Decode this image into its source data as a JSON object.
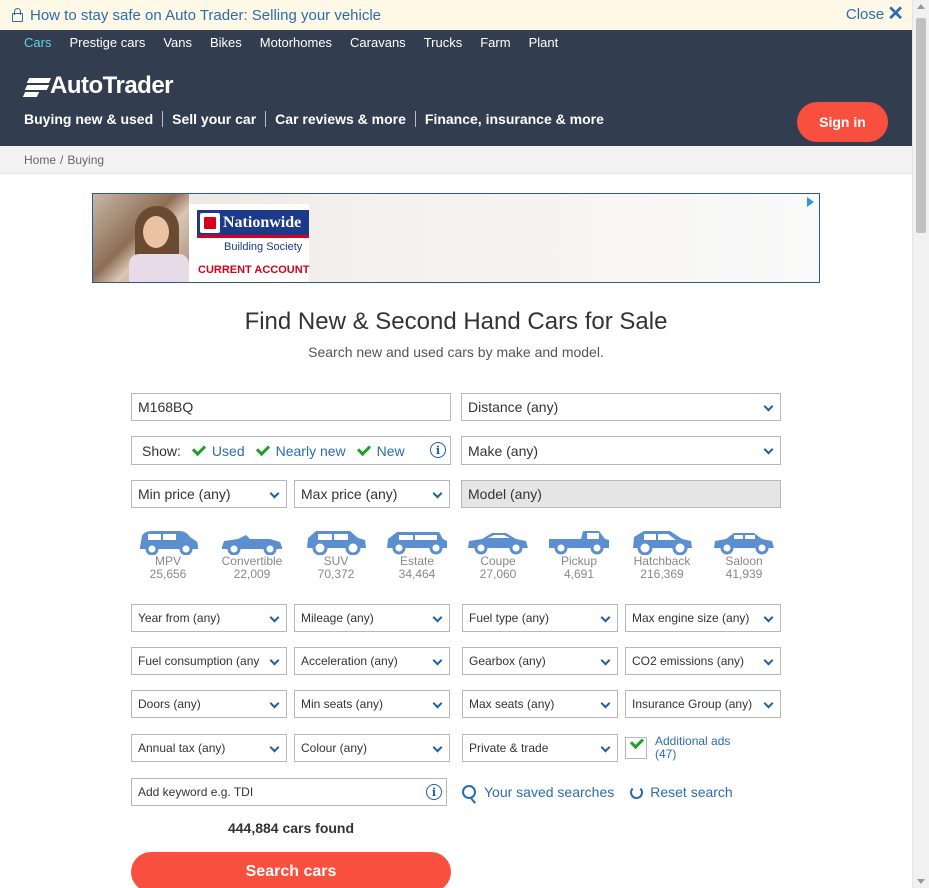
{
  "notice": {
    "message": "How to stay safe on Auto Trader: Selling your vehicle",
    "close_label": "Close"
  },
  "vehicle_tabs": [
    "Cars",
    "Prestige cars",
    "Vans",
    "Bikes",
    "Motorhomes",
    "Caravans",
    "Trucks",
    "Farm",
    "Plant"
  ],
  "logo_text": "AutoTrader",
  "main_nav": [
    "Buying new & used",
    "Sell your car",
    "Car reviews & more",
    "Finance, insurance & more"
  ],
  "sign_in": "Sign in",
  "breadcrumb": {
    "home": "Home",
    "current": "Buying"
  },
  "ad": {
    "brand": "Nationwide",
    "sub": "Building Society",
    "product": "CURRENT ACCOUNT"
  },
  "heading": "Find New & Second Hand Cars for Sale",
  "subheading": "Search new and used cars by make and model.",
  "search": {
    "postcode": "M168BQ",
    "distance": "Distance (any)",
    "show_label": "Show:",
    "show_options": [
      "Used",
      "Nearly new",
      "New"
    ],
    "make": "Make (any)",
    "min_price": "Min price (any)",
    "max_price": "Max price (any)",
    "model": "Model (any)"
  },
  "body_types": [
    {
      "name": "MPV",
      "count": "25,656"
    },
    {
      "name": "Convertible",
      "count": "22,009"
    },
    {
      "name": "SUV",
      "count": "70,372"
    },
    {
      "name": "Estate",
      "count": "34,464"
    },
    {
      "name": "Coupe",
      "count": "27,060"
    },
    {
      "name": "Pickup",
      "count": "4,691"
    },
    {
      "name": "Hatchback",
      "count": "216,369"
    },
    {
      "name": "Saloon",
      "count": "41,939"
    }
  ],
  "filters": {
    "year_from": "Year from (any)",
    "mileage": "Mileage (any)",
    "fuel_type": "Fuel type (any)",
    "max_engine": "Max engine size (any)",
    "fuel_consumption": "Fuel consumption (any",
    "acceleration": "Acceleration (any)",
    "gearbox": "Gearbox (any)",
    "co2": "CO2 emissions (any)",
    "doors": "Doors (any)",
    "min_seats": "Min seats (any)",
    "max_seats": "Max seats (any)",
    "insurance": "Insurance Group (any)",
    "annual_tax": "Annual tax (any)",
    "colour": "Colour (any)",
    "seller": "Private & trade",
    "additional_ads_line1": "Additional ads",
    "additional_ads_line2": "(47)"
  },
  "keyword_placeholder": "Add keyword e.g. TDI",
  "saved_searches": "Your saved searches",
  "reset_search": "Reset search",
  "cars_found": "444,884 cars found",
  "search_button": "Search cars",
  "colors": {
    "accent": "#f94f3e",
    "header": "#333d50",
    "link": "#2b6cb0",
    "check": "#1ea12a",
    "icon_blue": "#5b8fd0"
  }
}
